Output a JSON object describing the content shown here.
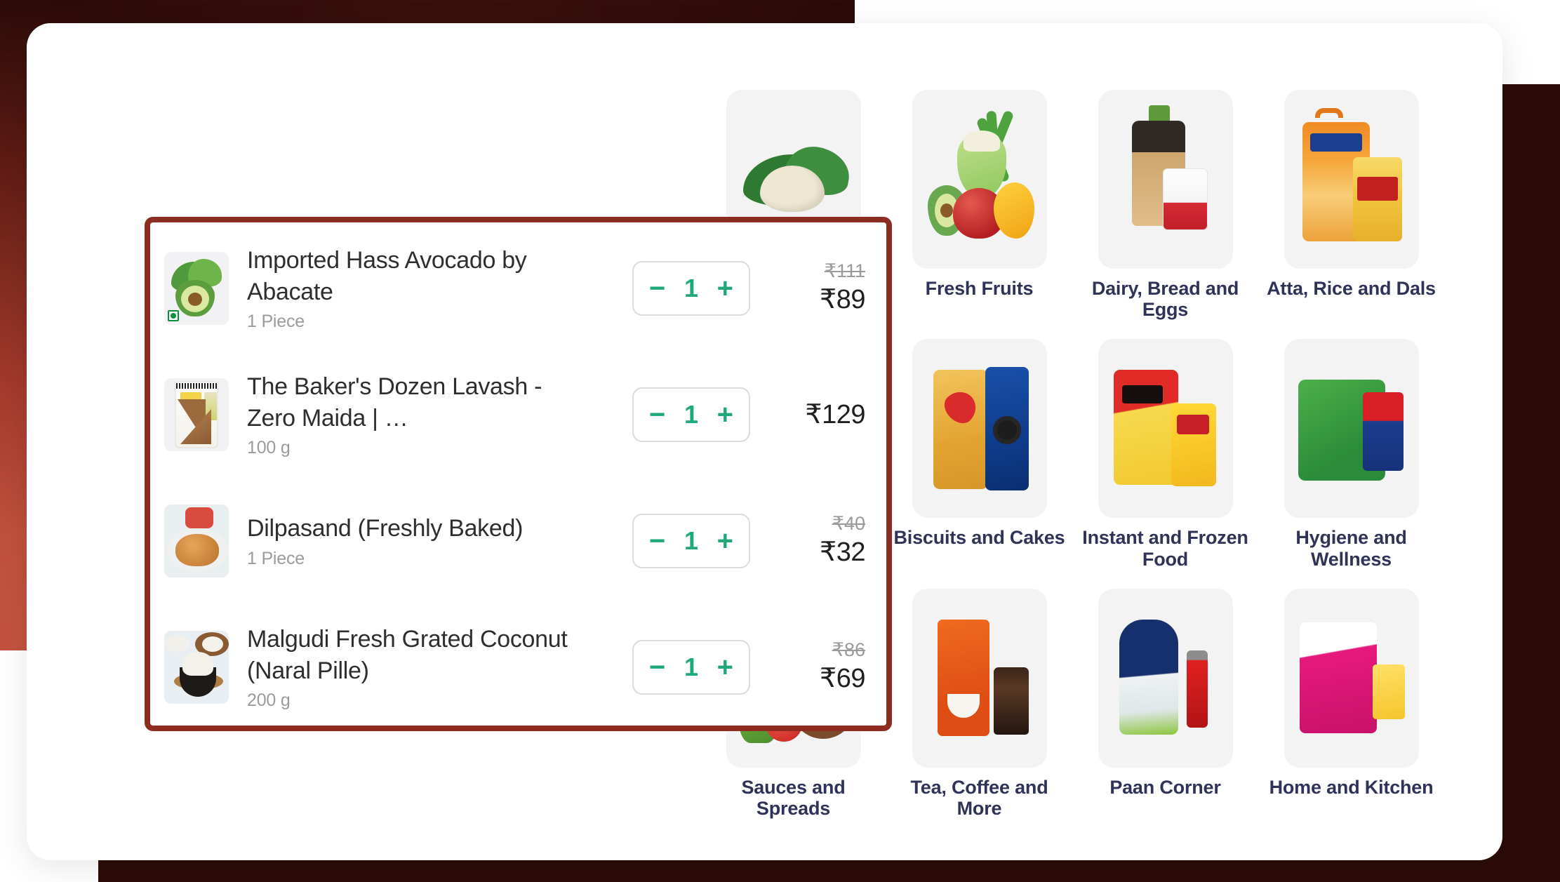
{
  "theme": {
    "highlight_border_color": "#8d2d21",
    "accent_green": "#1fa97a",
    "category_label_color": "#2f3357",
    "backdrop_color": "#2b0b08",
    "left_accent_red": "#c4543f"
  },
  "cart": {
    "items": [
      {
        "name": "Imported Hass Avocado by Abacate",
        "unit": "1 Piece",
        "quantity": "1",
        "price_original": "₹111",
        "price_current": "₹89",
        "has_discount": true,
        "veg_badge": true,
        "image": "avocado-thumbnail"
      },
      {
        "name": "The Baker's Dozen Lavash - Zero Maida | …",
        "unit": "100 g",
        "quantity": "1",
        "price_original": "",
        "price_current": "₹129",
        "has_discount": false,
        "veg_badge": false,
        "image": "lavash-thumbnail"
      },
      {
        "name": "Dilpasand (Freshly Baked)",
        "unit": "1 Piece",
        "quantity": "1",
        "price_original": "₹40",
        "price_current": "₹32",
        "has_discount": true,
        "veg_badge": false,
        "image": "dilpasand-thumbnail"
      },
      {
        "name": "Malgudi Fresh Grated Coconut (Naral Pille)",
        "unit": "200 g",
        "quantity": "1",
        "price_original": "₹86",
        "price_current": "₹69",
        "has_discount": true,
        "veg_badge": false,
        "image": "coconut-thumbnail"
      }
    ],
    "stepper": {
      "decrement_label": "−",
      "increment_label": "+"
    }
  },
  "categories": {
    "rows": [
      [
        {
          "label": "",
          "image": "fresh-vegetables-tile",
          "hidden_label": true
        },
        {
          "label": "Fresh Fruits",
          "image": "fresh-fruits-tile"
        },
        {
          "label": "Dairy, Bread and Eggs",
          "image": "dairy-bread-eggs-tile"
        },
        {
          "label": "Atta, Rice and Dals",
          "image": "atta-rice-dals-tile"
        }
      ],
      [
        {
          "label": "",
          "image": "empty-tile",
          "hidden_label": true
        },
        {
          "label": "Biscuits and Cakes",
          "image": "biscuits-cakes-tile"
        },
        {
          "label": "Instant and Frozen Food",
          "image": "instant-frozen-food-tile"
        },
        {
          "label": "Hygiene and Wellness",
          "image": "hygiene-wellness-tile"
        }
      ],
      [
        {
          "label": "Sauces and Spreads",
          "image": "sauces-spreads-tile"
        },
        {
          "label": "Tea, Coffee and More",
          "image": "tea-coffee-tile"
        },
        {
          "label": "Paan Corner",
          "image": "paan-corner-tile"
        },
        {
          "label": "Home and Kitchen",
          "image": "home-kitchen-tile"
        }
      ]
    ]
  }
}
